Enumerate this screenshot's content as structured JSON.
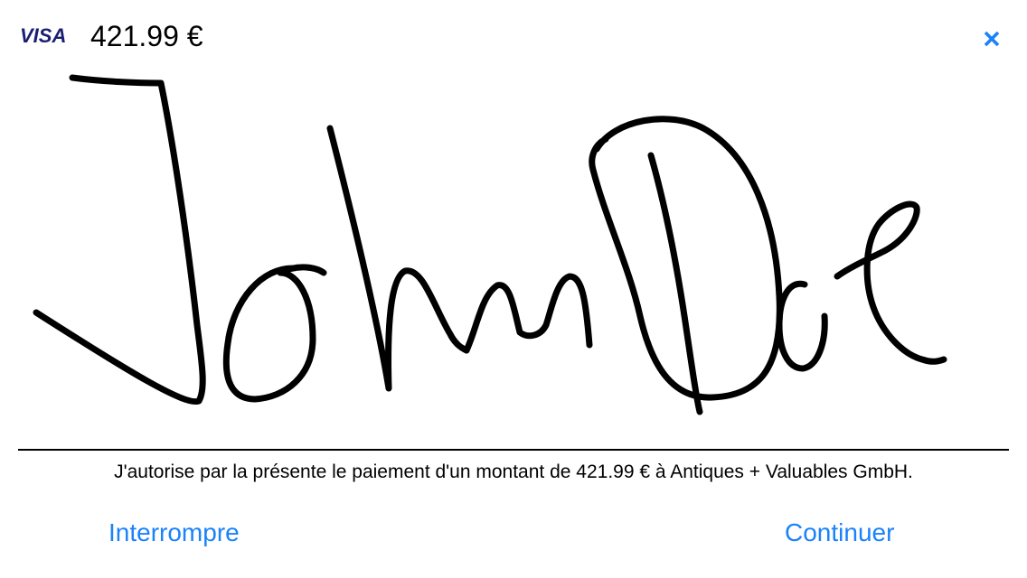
{
  "header": {
    "card_brand": "VISA",
    "amount": "421.99 €",
    "close_icon": "close-icon",
    "close_label": "x"
  },
  "signature": {
    "signer_name": "John Doe",
    "stroke_color": "#000000"
  },
  "footer": {
    "authorization_text": "J'autorise par la présente le paiement d'un montant de 421.99 € à Antiques + Valuables GmbH.",
    "abort_label": "Interrompre",
    "continue_label": "Continuer"
  },
  "colors": {
    "accent": "#1a82fb",
    "visa_brand": "#1a1f71",
    "text": "#000000",
    "background": "#ffffff"
  }
}
